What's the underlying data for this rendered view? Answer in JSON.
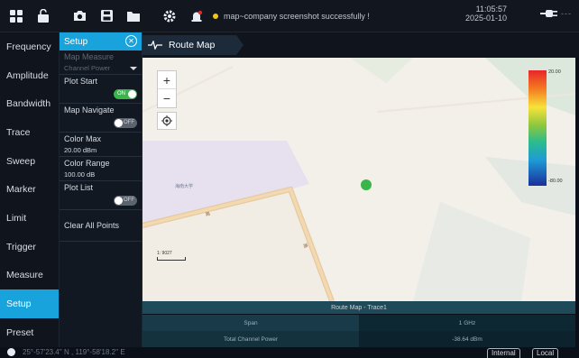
{
  "topbar": {
    "message": "map~company screenshot successfully !",
    "time": "11:05:57",
    "date": "2025-01-10",
    "power_suffix": "---",
    "icons": [
      "grid-icon",
      "unlock-icon",
      "camera-icon",
      "save-icon",
      "folder-icon",
      "settings-icon",
      "alarm-icon",
      "plug-icon"
    ]
  },
  "left_menu": {
    "items": [
      {
        "label": "Frequency"
      },
      {
        "label": "Amplitude"
      },
      {
        "label": "Bandwidth"
      },
      {
        "label": "Trace"
      },
      {
        "label": "Sweep"
      },
      {
        "label": "Marker"
      },
      {
        "label": "Limit"
      },
      {
        "label": "Trigger"
      },
      {
        "label": "Measure"
      },
      {
        "label": "Setup"
      },
      {
        "label": "Preset"
      }
    ],
    "active": "Setup",
    "accent_color": "#19a3dc"
  },
  "setup_panel": {
    "title": "Setup",
    "map_measure": {
      "label": "Map Measure",
      "value": "Channel Power"
    },
    "plot_start": {
      "label": "Plot Start",
      "state": "ON"
    },
    "map_navigate": {
      "label": "Map Navigate",
      "state": "OFF"
    },
    "color_max": {
      "label": "Color Max",
      "value": "20.00 dBm"
    },
    "color_range": {
      "label": "Color Range",
      "value": "100.00 dB"
    },
    "plot_list": {
      "label": "Plot List",
      "state": "OFF"
    },
    "clear_all": {
      "label": "Clear All Points"
    }
  },
  "route_map": {
    "tab_label": "Route Map",
    "scale_label": "1: 9027",
    "campus_label": "海南大学",
    "road_label_1": "路",
    "road_label_2": "路",
    "colorbar_max": "20.00",
    "colorbar_min": "-80.00",
    "point_color": "#3ab54a"
  },
  "results_table": {
    "title": "Route Map - Trace1",
    "rows": [
      {
        "label": "Span",
        "value": "1 GHz"
      },
      {
        "label": "Total Channel Power",
        "value": "-38.64 dBm"
      }
    ]
  },
  "bottombar": {
    "coordinates": "25°-57'23.4'' N , 119°-58'18.2'' E",
    "internal_label": "Internal",
    "local_label": "Local"
  }
}
